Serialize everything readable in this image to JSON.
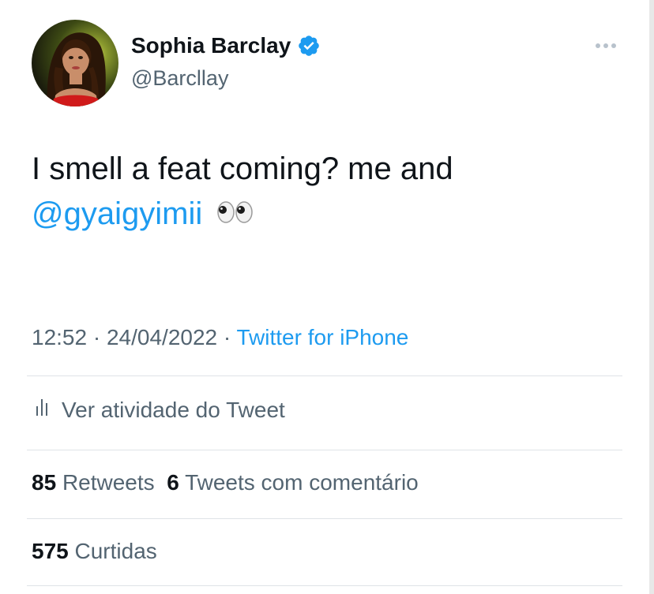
{
  "tweet": {
    "author_name": "Sophia Barclay",
    "handle": "@Barcllay",
    "text_line1": "I smell a feat coming? me and",
    "mention": "@gyaigyimii",
    "emoji": "👀",
    "time": "12:52",
    "separator": "·",
    "date": "24/04/2022",
    "source": "Twitter for iPhone"
  },
  "activity": {
    "label": "Ver atividade do Tweet"
  },
  "stats": {
    "retweets_count": "85",
    "retweets_label": "Retweets",
    "quotes_count": "6",
    "quotes_label": "Tweets com comentário",
    "likes_count": "575",
    "likes_label": "Curtidas"
  },
  "icons": {
    "verified": "verified-badge-icon",
    "more": "more-options-icon",
    "activity": "bar-chart-icon"
  },
  "colors": {
    "accent": "#1d9bf0",
    "text": "#0f1419",
    "muted": "#536471",
    "divider": "#dfe3e7"
  }
}
